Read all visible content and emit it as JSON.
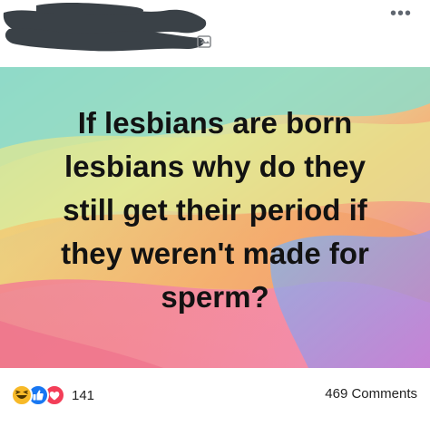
{
  "post": {
    "text": "If lesbians are born\nlesbians why do they\nstill get their period if\nthey weren't made for\nsperm?"
  },
  "header": {
    "menu_label": "•••",
    "audience_icon": "globe-icon"
  },
  "footer": {
    "reactions": [
      "haha-reaction-icon",
      "like-reaction-icon",
      "love-reaction-icon"
    ],
    "reaction_count": "141",
    "comments_label": "469 Comments"
  },
  "colors": {
    "redaction": "#3a4147",
    "text": "#121212",
    "like": "#1877f2",
    "love": "#f33e58",
    "haha": "#f7b928"
  }
}
